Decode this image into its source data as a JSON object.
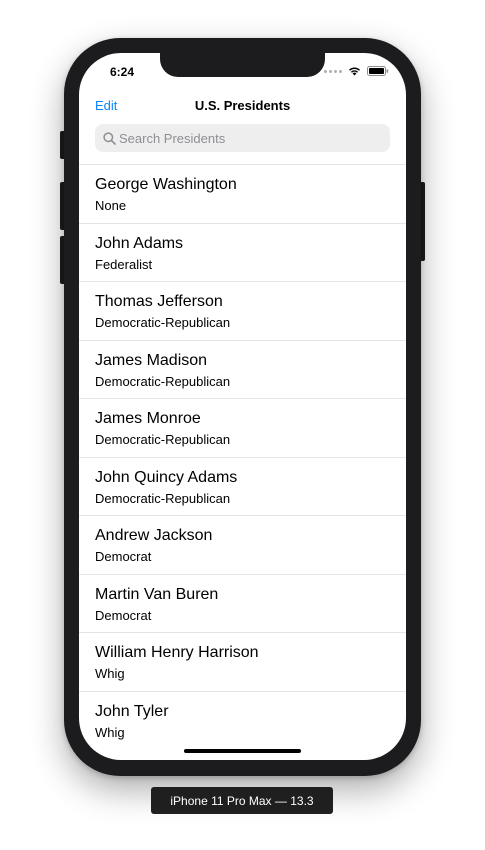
{
  "status_bar": {
    "time": "6:24"
  },
  "nav": {
    "edit_label": "Edit",
    "title": "U.S. Presidents"
  },
  "search": {
    "placeholder": "Search Presidents",
    "value": ""
  },
  "presidents": [
    {
      "name": "George Washington",
      "party": "None"
    },
    {
      "name": "John Adams",
      "party": "Federalist"
    },
    {
      "name": "Thomas Jefferson",
      "party": "Democratic-Republican"
    },
    {
      "name": "James Madison",
      "party": "Democratic-Republican"
    },
    {
      "name": "James Monroe",
      "party": "Democratic-Republican"
    },
    {
      "name": "John Quincy Adams",
      "party": "Democratic-Republican"
    },
    {
      "name": "Andrew Jackson",
      "party": "Democrat"
    },
    {
      "name": "Martin Van Buren",
      "party": "Democrat"
    },
    {
      "name": "William Henry Harrison",
      "party": "Whig"
    },
    {
      "name": "John Tyler",
      "party": "Whig"
    }
  ],
  "device_label": "iPhone 11 Pro Max — 13.3",
  "colors": {
    "accent": "#0a84ff",
    "device_frame": "#1c1c1e"
  }
}
